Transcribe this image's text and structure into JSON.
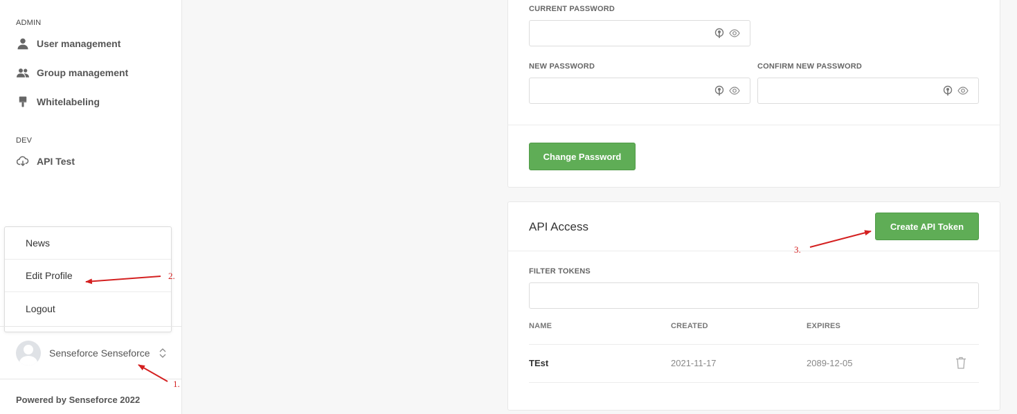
{
  "sidebar": {
    "sections": [
      {
        "label": "ADMIN",
        "items": [
          {
            "label": "User management",
            "icon": "user-icon"
          },
          {
            "label": "Group management",
            "icon": "group-icon"
          },
          {
            "label": "Whitelabeling",
            "icon": "brush-icon"
          }
        ]
      },
      {
        "label": "DEV",
        "items": [
          {
            "label": "API Test",
            "icon": "cloud-download-icon"
          }
        ]
      }
    ],
    "dropdown": {
      "items": [
        {
          "label": "News"
        },
        {
          "label": "Edit Profile"
        },
        {
          "label": "Logout"
        }
      ]
    },
    "profile": {
      "name": "Senseforce Senseforce"
    },
    "footer": "Powered by Senseforce 2022"
  },
  "password_card": {
    "current_password_label": "CURRENT PASSWORD",
    "new_password_label": "NEW PASSWORD",
    "confirm_password_label": "CONFIRM NEW PASSWORD",
    "change_button": "Change Password"
  },
  "api_card": {
    "title": "API Access",
    "create_button": "Create API Token",
    "filter_label": "FILTER TOKENS",
    "columns": [
      "NAME",
      "CREATED",
      "EXPIRES"
    ],
    "rows": [
      {
        "name": "TEst",
        "created": "2021-11-17",
        "expires": "2089-12-05"
      }
    ]
  },
  "annotations": {
    "a1": "1.",
    "a2": "2.",
    "a3": "3."
  },
  "colors": {
    "accent_green": "#5fad56",
    "annotation_red": "#d42020"
  }
}
